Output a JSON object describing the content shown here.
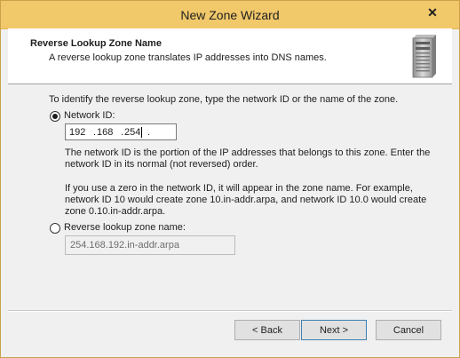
{
  "window": {
    "title": "New Zone Wizard",
    "close_glyph": "✕"
  },
  "header": {
    "title": "Reverse Lookup Zone Name",
    "subtitle": "A reverse lookup zone translates IP addresses into DNS names.",
    "icon": "server-icon"
  },
  "main": {
    "intro": "To identify the reverse lookup zone, type the network ID or the name of the zone.",
    "network_id": {
      "label": "Network ID:",
      "selected": true,
      "octets": [
        "192",
        "168",
        "254",
        ""
      ],
      "separator": "."
    },
    "description1": "The network ID is the portion of the IP addresses that belongs to this zone. Enter the network ID in its normal (not reversed) order.",
    "description2": "If you use a zero in the network ID, it will appear in the zone name. For example, network ID 10 would create zone 10.in-addr.arpa, and network ID 10.0 would create zone 0.10.in-addr.arpa.",
    "zone_name": {
      "label": "Reverse lookup zone name:",
      "selected": false,
      "value": "254.168.192.in-addr.arpa"
    }
  },
  "footer": {
    "back_label": "< Back",
    "next_label": "Next >",
    "cancel_label": "Cancel"
  }
}
